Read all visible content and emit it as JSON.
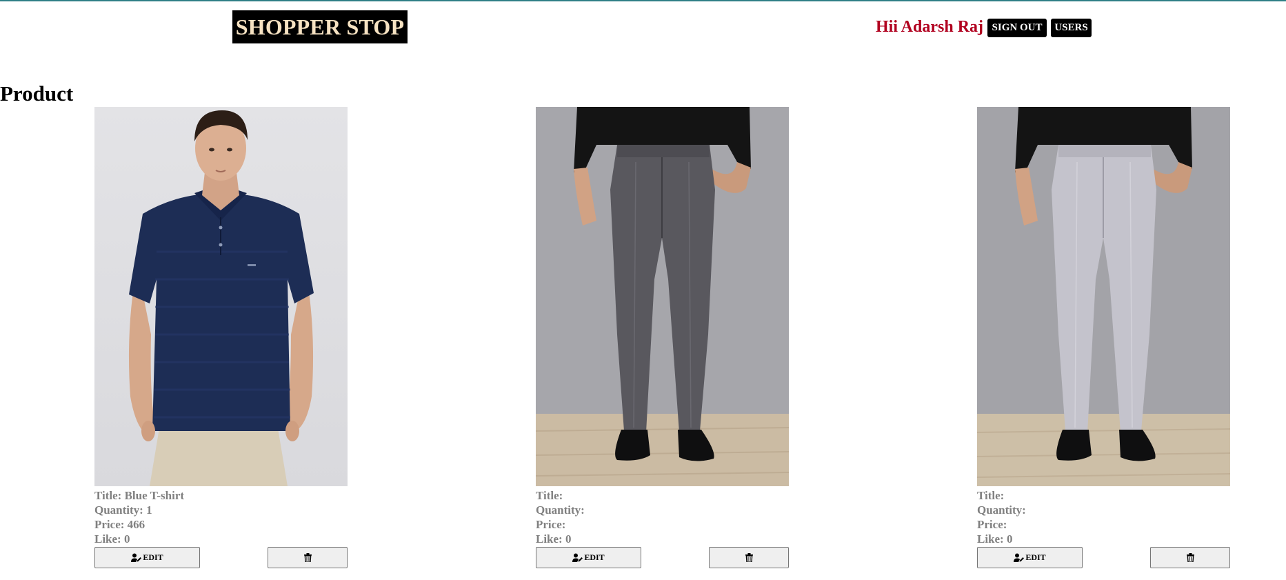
{
  "header": {
    "brand": "SHOPPER STOP",
    "greeting": "Hii Adarsh Raj",
    "sign_out_label": "SIGN OUT",
    "users_label": "USERS"
  },
  "page": {
    "heading": "Product"
  },
  "products": [
    {
      "image": "navy blue polo t-shirt on model",
      "title_label": "Title: Blue T-shirt",
      "quantity_label": "Quantity: 1",
      "price_label": "Price: 466",
      "like_label": "Like: 0",
      "edit_label": "EDIT"
    },
    {
      "image": "dark grey formal trousers on model",
      "title_label": "Title:",
      "quantity_label": "Quantity:",
      "price_label": "Price:",
      "like_label": "Like: 0",
      "edit_label": "EDIT"
    },
    {
      "image": "light grey formal trousers on model",
      "title_label": "Title:",
      "quantity_label": "Quantity:",
      "price_label": "Price:",
      "like_label": "Like: 0",
      "edit_label": "EDIT"
    }
  ],
  "icons": {
    "edit": "user-edit-icon",
    "delete": "trash-icon"
  },
  "colors": {
    "brand_bg": "#000000",
    "brand_text": "#f6e2c2",
    "greeting": "#b1001f",
    "info_text": "#808080"
  }
}
